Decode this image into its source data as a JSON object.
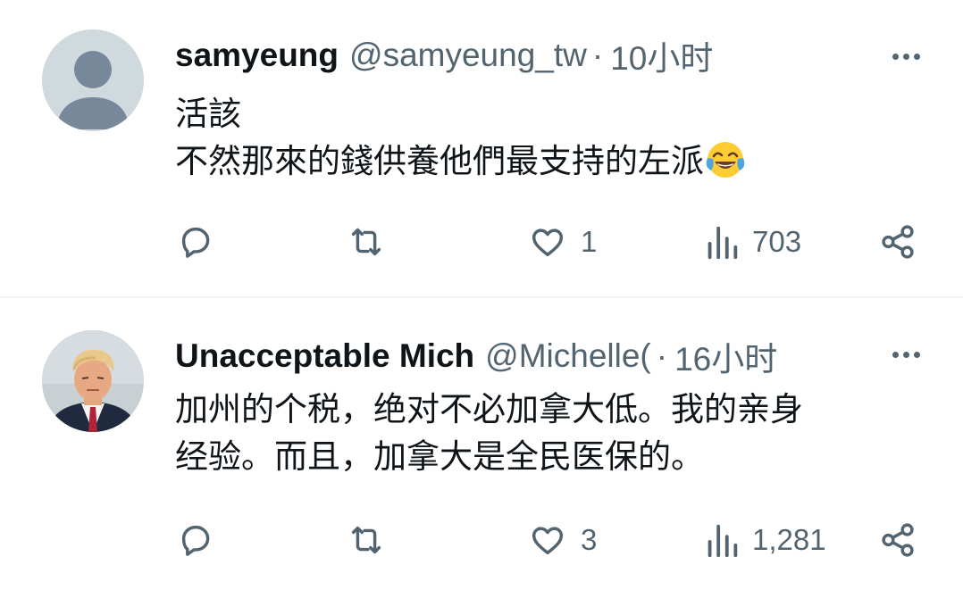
{
  "tweets": [
    {
      "display_name": "samyeung",
      "handle": "@samyeung_tw",
      "separator": "·",
      "time": "10小时",
      "lines": [
        "活該",
        "不然那來的錢供養他們最支持的左派"
      ],
      "emoji": "face-with-tears-of-joy",
      "avatar": "default-profile-avatar",
      "reply_count": "",
      "retweet_count": "",
      "like_count": "1",
      "view_count": "703"
    },
    {
      "display_name": "Unacceptable Mich",
      "handle": "@Michelle(",
      "separator": "·",
      "time": "16小时",
      "lines": [
        "加州的个税，绝对不必加拿大低。我的亲身",
        "经验。而且，加拿大是全民医保的。"
      ],
      "avatar": "profile-photo-man-in-suit",
      "reply_count": "",
      "retweet_count": "",
      "like_count": "3",
      "view_count": "1,281"
    }
  ],
  "colors": {
    "text_primary": "#0f1419",
    "text_secondary": "#536471",
    "divider": "#eff3f4",
    "default_avatar_bg": "#cfd9de",
    "default_avatar_fg": "#7a8b98"
  }
}
